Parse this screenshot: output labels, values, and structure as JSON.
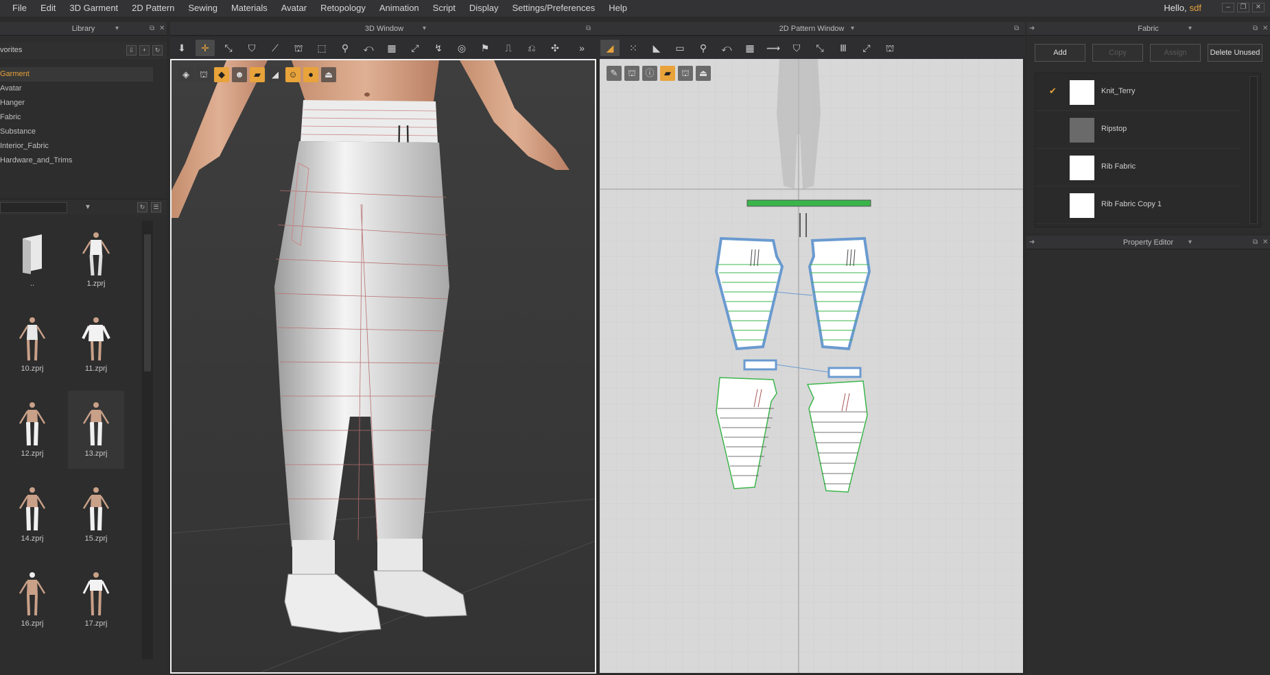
{
  "menu": [
    "File",
    "Edit",
    "3D Garment",
    "2D Pattern",
    "Sewing",
    "Materials",
    "Avatar",
    "Retopology",
    "Animation",
    "Script",
    "Display",
    "Settings/Preferences",
    "Help"
  ],
  "greeting": {
    "hello": "Hello,",
    "user": "sdf"
  },
  "library": {
    "title": "Library",
    "favorites_label": "vorites",
    "tree": [
      "Garment",
      "Avatar",
      "Hanger",
      "Fabric",
      "Substance",
      "Interior_Fabric",
      "Hardware_and_Trims"
    ],
    "active_tree_item": "Garment",
    "files": [
      "..",
      "1.zprj",
      "10.zprj",
      "11.zprj",
      "12.zprj",
      "13.zprj",
      "14.zprj",
      "15.zprj",
      "16.zprj",
      "17.zprj"
    ],
    "selected_file": "13.zprj"
  },
  "view3d": {
    "title": "3D Window"
  },
  "view2d": {
    "title": "2D Pattern Window"
  },
  "fabric": {
    "title": "Fabric",
    "buttons": {
      "add": "Add",
      "copy": "Copy",
      "assign": "Assign",
      "delete_unused": "Delete Unused"
    },
    "items": [
      {
        "name": "Knit_Terry",
        "checked": true
      },
      {
        "name": "Ripstop",
        "checked": false
      },
      {
        "name": "Rib Fabric",
        "checked": false
      },
      {
        "name": "Rib Fabric Copy 1",
        "checked": false
      }
    ]
  },
  "property_editor": {
    "title": "Property Editor"
  },
  "colors": {
    "accent": "#e8a33a",
    "pattern_green": "#3ab54a",
    "pattern_blue": "#6a9ad0",
    "viewport_3d_bg": "#3a3a3a",
    "viewport_2d_bg": "#d8d8d8"
  }
}
